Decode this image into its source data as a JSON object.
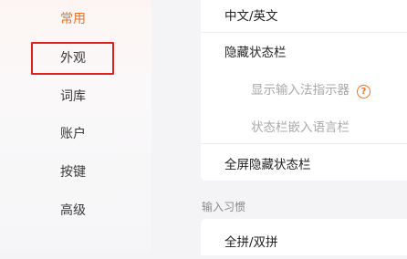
{
  "sidebar": {
    "items": [
      {
        "label": "常用",
        "active": true
      },
      {
        "label": "外观",
        "active": false
      },
      {
        "label": "词库",
        "active": false
      },
      {
        "label": "账户",
        "active": false
      },
      {
        "label": "按键",
        "active": false
      },
      {
        "label": "高级",
        "active": false
      }
    ]
  },
  "settings": {
    "rows": [
      {
        "label": "中文/英文"
      },
      {
        "label": "隐藏状态栏"
      },
      {
        "label": "显示输入法指示器"
      },
      {
        "label": "状态栏嵌入语言栏"
      },
      {
        "label": "全屏隐藏状态栏"
      }
    ],
    "help_icon": "question-circle-icon"
  },
  "input_habits": {
    "title": "输入习惯",
    "rows": [
      {
        "label": "全拼/双拼"
      }
    ]
  },
  "colors": {
    "accent": "#f0711e",
    "highlight_box": "#e0201e"
  }
}
